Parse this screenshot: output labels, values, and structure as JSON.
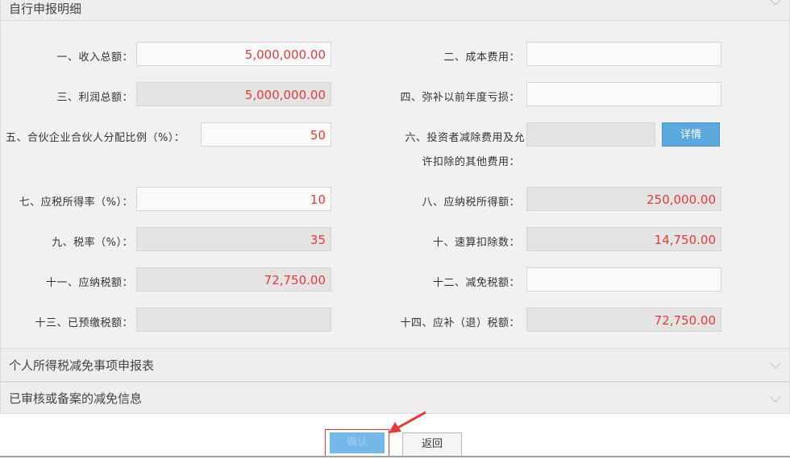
{
  "sections": {
    "main_title": "自行申报明细",
    "reduction_title": "个人所得税减免事项申报表",
    "approved_title": "已审核或备案的减免信息"
  },
  "fields": {
    "f1": {
      "label": "一、收入总额：",
      "value": "5,000,000.00"
    },
    "f2": {
      "label": "二、成本费用：",
      "value": ""
    },
    "f3": {
      "label": "三、利润总额：",
      "value": "5,000,000.00"
    },
    "f4": {
      "label": "四、弥补以前年度亏损：",
      "value": ""
    },
    "f5": {
      "label": "五、合伙企业合伙人分配比例（%）：",
      "value": "50"
    },
    "f6": {
      "label_line1": "六、投资者减除费用及允",
      "label_line2": "许扣除的其他费用：",
      "value": ""
    },
    "f7": {
      "label": "七、应税所得率（%）：",
      "value": "10"
    },
    "f8": {
      "label": "八、应纳税所得额：",
      "value": "250,000.00"
    },
    "f9": {
      "label": "九、税率（%）：",
      "value": "35"
    },
    "f10": {
      "label": "十、速算扣除数：",
      "value": "14,750.00"
    },
    "f11": {
      "label": "十一、应纳税额：",
      "value": "72,750.00"
    },
    "f12": {
      "label": "十二、减免税额：",
      "value": ""
    },
    "f13": {
      "label": "十三、已预缴税额：",
      "value": ""
    },
    "f14": {
      "label": "十四、应补（退）税额：",
      "value": "72,750.00"
    }
  },
  "buttons": {
    "detail": "详情",
    "confirm": "确认",
    "back": "返回"
  },
  "colors": {
    "value_text": "#e53935",
    "primary_button": "#5ba8dd",
    "highlight_box": "#e53935",
    "annotation_arrow": "#e53935"
  },
  "icons": {
    "collapse": "chevron-down-icon",
    "annotation": "arrow-icon"
  }
}
